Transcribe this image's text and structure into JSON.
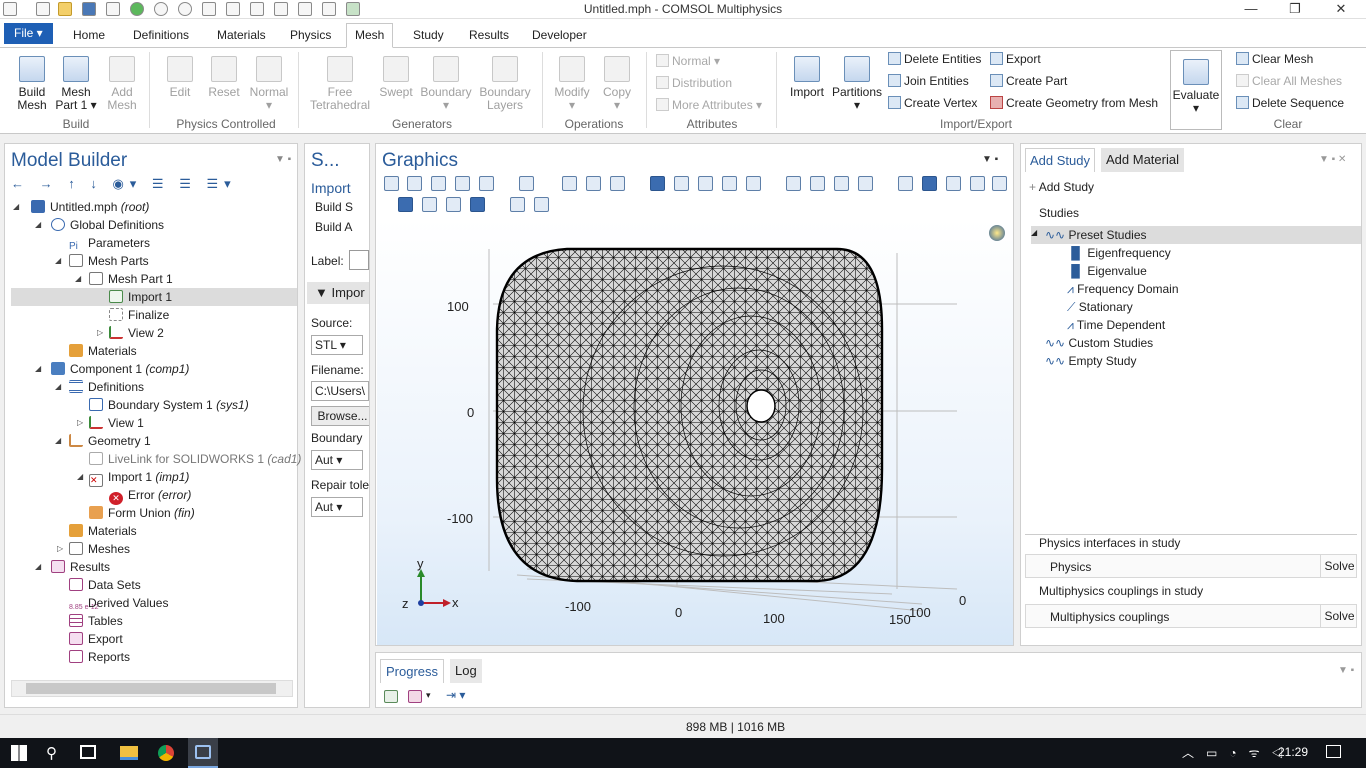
{
  "window": {
    "title": "Untitled.mph - COMSOL Multiphysics"
  },
  "tabs": [
    "File ▾",
    "Home",
    "Definitions",
    "Materials",
    "Physics",
    "Mesh",
    "Study",
    "Results",
    "Developer"
  ],
  "ribbon": {
    "build": {
      "build_mesh": "Build\nMesh",
      "mesh_part": "Mesh\nPart 1 ▾",
      "add_mesh": "Add\nMesh",
      "group": "Build"
    },
    "physics_controlled": {
      "edit": "Edit",
      "reset": "Reset",
      "normal": "Normal\n▾",
      "group": "Physics Controlled"
    },
    "generators": {
      "free_tet": "Free\nTetrahedral",
      "swept": "Swept",
      "boundary": "Boundary\n▾",
      "boundary_layers": "Boundary\nLayers",
      "group": "Generators"
    },
    "operations": {
      "modify": "Modify\n▾",
      "copy": "Copy\n▾",
      "group": "Operations"
    },
    "attributes": {
      "normal": "Normal ▾",
      "distribution": "Distribution",
      "more": "More Attributes ▾",
      "group": "Attributes"
    },
    "import_export": {
      "import": "Import",
      "partitions": "Partitions\n▾",
      "delete_entities": "Delete Entities",
      "join_entities": "Join Entities",
      "create_vertex": "Create Vertex",
      "export": "Export",
      "create_part": "Create Part",
      "create_geom": "Create Geometry from Mesh",
      "group": "Import/Export"
    },
    "evaluate": "Evaluate\n▾",
    "clear": {
      "clear_mesh": "Clear Mesh",
      "clear_all": "Clear All Meshes",
      "delete_seq": "Delete Sequence",
      "group": "Clear"
    }
  },
  "model_builder": {
    "title": "Model Builder",
    "nodes": [
      {
        "label": "Untitled.mph",
        "tag": "(root)"
      },
      {
        "label": "Global Definitions",
        "tag": ""
      },
      {
        "label": "Parameters",
        "tag": ""
      },
      {
        "label": "Mesh Parts",
        "tag": ""
      },
      {
        "label": "Mesh Part 1",
        "tag": ""
      },
      {
        "label": "Import 1",
        "tag": ""
      },
      {
        "label": "Finalize",
        "tag": ""
      },
      {
        "label": "View 2",
        "tag": ""
      },
      {
        "label": "Materials",
        "tag": ""
      },
      {
        "label": "Component 1",
        "tag": "(comp1)"
      },
      {
        "label": "Definitions",
        "tag": ""
      },
      {
        "label": "Boundary System 1",
        "tag": "(sys1)"
      },
      {
        "label": "View 1",
        "tag": ""
      },
      {
        "label": "Geometry 1",
        "tag": ""
      },
      {
        "label": "LiveLink for SOLIDWORKS 1",
        "tag": "(cad1)"
      },
      {
        "label": "Import 1",
        "tag": "(imp1)"
      },
      {
        "label": "Error",
        "tag": "(error)"
      },
      {
        "label": "Form Union",
        "tag": "(fin)"
      },
      {
        "label": "Materials",
        "tag": ""
      },
      {
        "label": "Meshes",
        "tag": ""
      },
      {
        "label": "Results",
        "tag": ""
      },
      {
        "label": "Data Sets",
        "tag": ""
      },
      {
        "label": "Derived Values",
        "tag": ""
      },
      {
        "label": "Tables",
        "tag": ""
      },
      {
        "label": "Export",
        "tag": ""
      },
      {
        "label": "Reports",
        "tag": ""
      }
    ]
  },
  "settings": {
    "title": "S...",
    "subtitle": "Import",
    "build_s": "Build S",
    "build_a": "Build A",
    "label": "Label:",
    "section": "Impor",
    "source_label": "Source:",
    "source_value": "STL",
    "filename_label": "Filename:",
    "filename_value": "C:\\Users\\",
    "browse": "Browse...",
    "boundary_label": "Boundary",
    "boundary_value": "Aut",
    "repair_label": "Repair tole",
    "repair_value": "Aut"
  },
  "graphics": {
    "title": "Graphics",
    "yticks": [
      "100",
      "0",
      "-100"
    ],
    "xticks": [
      "-100",
      "0",
      "100",
      "150"
    ],
    "zticks": [
      "100",
      "0"
    ],
    "axes": {
      "y": "y",
      "x": "x",
      "z": "z"
    }
  },
  "add_study": {
    "tab1": "Add Study",
    "tab2": "Add Material",
    "add_button": "Add Study",
    "studies_label": "Studies",
    "preset": "Preset Studies",
    "items": [
      "Eigenfrequency",
      "Eigenvalue",
      "Frequency Domain",
      "Stationary",
      "Time Dependent"
    ],
    "custom": "Custom Studies",
    "empty": "Empty Study",
    "physics_header": "Physics interfaces in study",
    "physics_col": "Physics",
    "solve1": "Solve",
    "multi_header": "Multiphysics couplings in study",
    "multi_col": "Multiphysics couplings",
    "solve2": "Solve"
  },
  "bottom": {
    "tab1": "Progress",
    "tab2": "Log"
  },
  "status": {
    "memory": "898 MB | 1016 MB"
  },
  "taskbar": {
    "time": "21:29"
  },
  "colors": {
    "accent": "#1e5fb5",
    "title_blue": "#2b5c9a"
  }
}
